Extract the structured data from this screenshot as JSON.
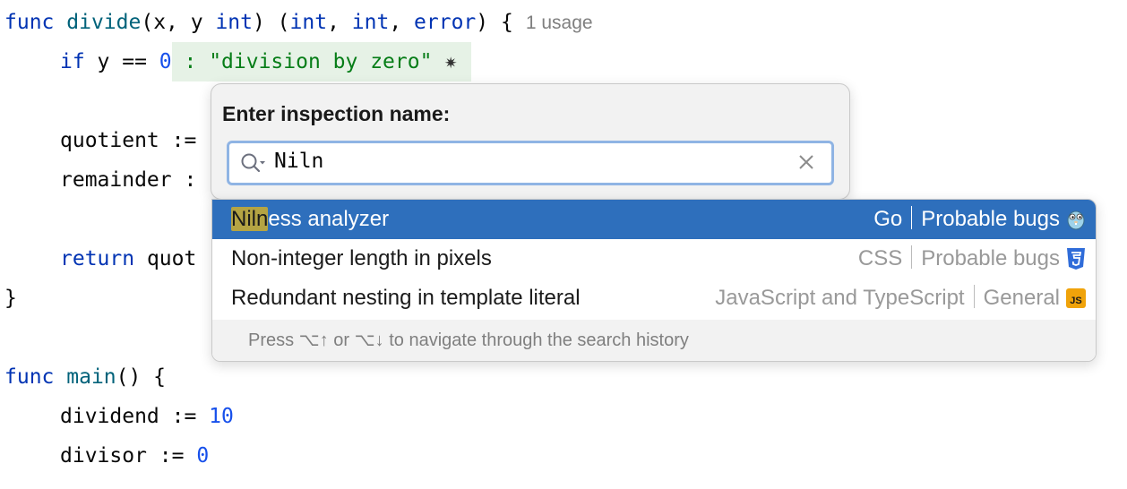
{
  "code": {
    "line1": {
      "kw": "func",
      "fn": "divide",
      "params": "(x, y ",
      "type1": "int",
      "mid": ") (",
      "type2": "int",
      "comma": ", ",
      "type3": "int",
      "comma2": ", ",
      "type4": "error",
      "end": ") {",
      "usage": "1 usage"
    },
    "line2": {
      "kw": "if",
      "expr": " y == ",
      "num": "0",
      "hint": " : \"division by zero\" ",
      "star": "✷"
    },
    "line3": {
      "text": "quotient :="
    },
    "line4": {
      "text": "remainder :"
    },
    "line5": {
      "kw": "return",
      "text": " quot"
    },
    "line6": {
      "text": "}"
    },
    "line7": {
      "kw": "func",
      "fn": "main",
      "end": "() {"
    },
    "line8": {
      "text": "dividend := ",
      "num": "10"
    },
    "line9": {
      "text": "divisor := ",
      "num": "0"
    }
  },
  "popup": {
    "title": "Enter inspection name:",
    "search_value": "Niln",
    "search_icon": "search-icon",
    "clear_icon": "clear-icon"
  },
  "results": [
    {
      "match": "Niln",
      "rest": "ess analyzer",
      "language": "Go",
      "category": "Probable bugs",
      "icon": "gopher-icon",
      "selected": true
    },
    {
      "match": "",
      "rest": "Non-integer length in pixels",
      "language": "CSS",
      "category": "Probable bugs",
      "icon": "css3-icon",
      "selected": false
    },
    {
      "match": "",
      "rest": "Redundant nesting in template literal",
      "language": "JavaScript and TypeScript",
      "category": "General",
      "icon": "js-icon",
      "selected": false
    }
  ],
  "footer": {
    "text": "Press ⌥↑ or ⌥↓ to navigate through the search history"
  },
  "colors": {
    "selection": "#2e6fbc",
    "match_highlight": "#b5a443",
    "keyword": "#0033b3",
    "function": "#00627a",
    "number": "#1750eb",
    "string": "#067d17"
  }
}
